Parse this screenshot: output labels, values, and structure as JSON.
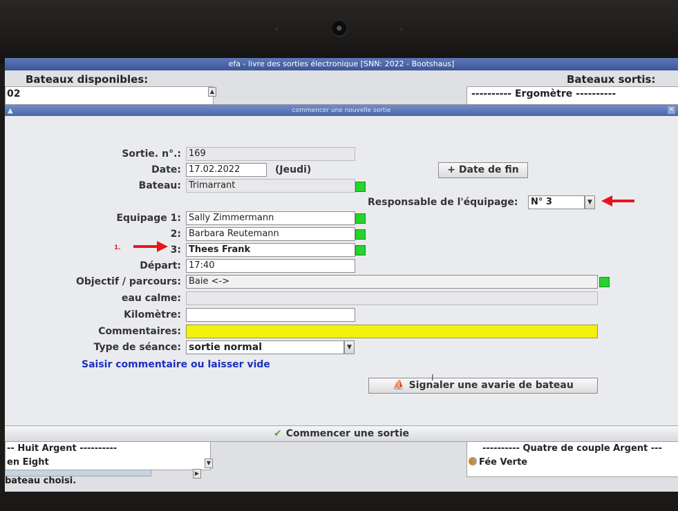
{
  "main_window": {
    "title": "efa - livre des sorties électronique [SNN: 2022 - Bootshaus]",
    "left_panel": {
      "heading": "Bateaux disponibles:",
      "top_items": [
        "02"
      ],
      "bottom_items": [
        "-- Huit Argent ----------",
        "en Eight"
      ]
    },
    "right_panel": {
      "heading": "Bateaux sortis:",
      "top_items": [
        "---------- Ergomètre ----------"
      ],
      "bottom_items": [
        "---------- Quatre de couple Argent ---",
        "Fée Verte"
      ]
    },
    "status": "bateau choisi."
  },
  "dialog": {
    "title": "commencer une nouvelle sortie",
    "fields": {
      "sortie_label": "Sortie. n°.:",
      "sortie_value": "169",
      "date_label": "Date:",
      "date_value": "17.02.2022",
      "weekday": "(Jeudi)",
      "bateau_label": "Bateau:",
      "bateau_value": "Trimarrant",
      "responsable_label": "Responsable de l'équipage:",
      "responsable_value": "N° 3",
      "crew1_label": "Equipage 1:",
      "crew1_value": "Sally Zimmermann",
      "crew2_label": "2:",
      "crew2_value": "Barbara Reutemann",
      "crew3_label": "3:",
      "crew3_value": "Thees Frank",
      "depart_label": "Départ:",
      "depart_value": "17:40",
      "objectif_label": "Objectif / parcours:",
      "objectif_value": "Baie <->",
      "eau_label": "eau calme:",
      "eau_value": "",
      "km_label": "Kilomètre:",
      "km_value": "",
      "comment_label": "Commentaires:",
      "comment_value": "",
      "type_label": "Type de séance:",
      "type_value": "sortie normal"
    },
    "date_fin_button": "+ Date de fin",
    "hint": "Saisir commentaire ou laisser vide",
    "avarie_button": "Signaler une avarie de bateau",
    "start_button": "Commencer une sortie",
    "annotation_number": "1."
  },
  "colors": {
    "ok_indicator": "#27d32c",
    "comment_highlight": "#f2f20d",
    "annotation_arrow": "#e8141b",
    "hint_text": "#1c2fbd",
    "title_bar": "#4d68ab"
  }
}
